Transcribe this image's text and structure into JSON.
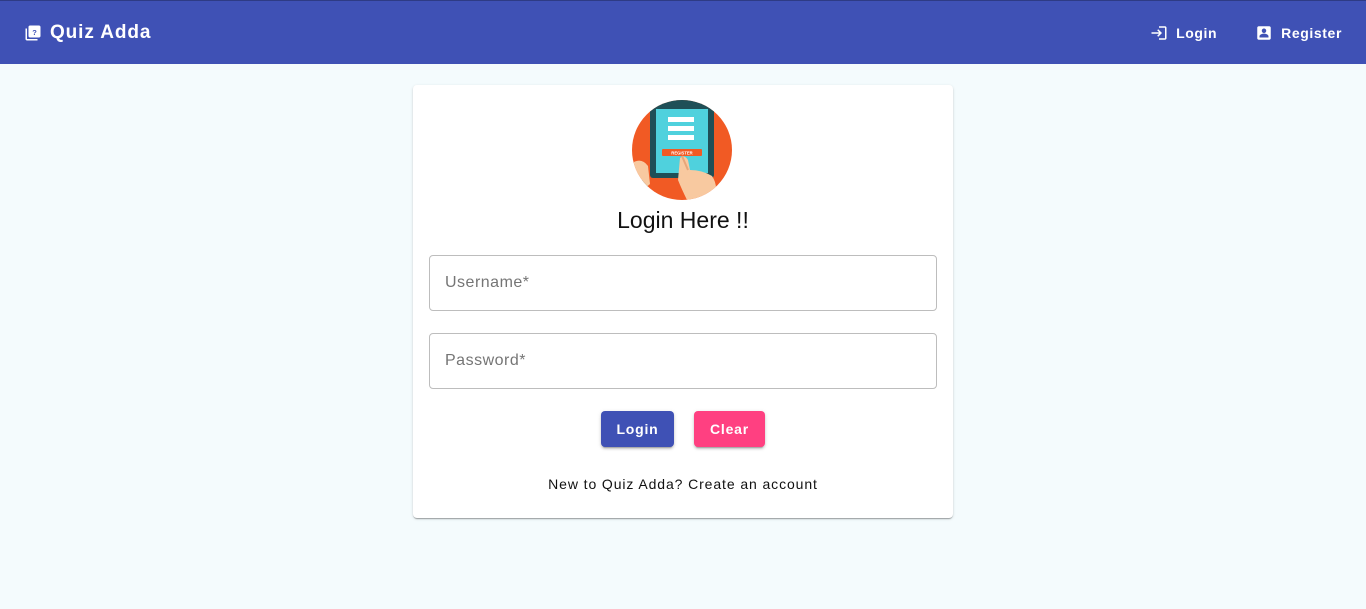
{
  "appbar": {
    "title": "Quiz Adda",
    "brand_icon": "quiz-book-icon",
    "nav": [
      {
        "label": "Login",
        "icon": "login-icon"
      },
      {
        "label": "Register",
        "icon": "contact-card-icon"
      }
    ],
    "color": "#3f51b5"
  },
  "card": {
    "illustration_text": "REGISTER",
    "title": "Login Here !!",
    "username_placeholder": "Username*",
    "password_placeholder": "Password*",
    "login_button": "Login",
    "clear_button": "Clear",
    "footer_text": "New to Quiz Adda? Create an account"
  },
  "colors": {
    "primary": "#3f51b5",
    "secondary": "#ff4081",
    "background": "#f4fbfd"
  }
}
